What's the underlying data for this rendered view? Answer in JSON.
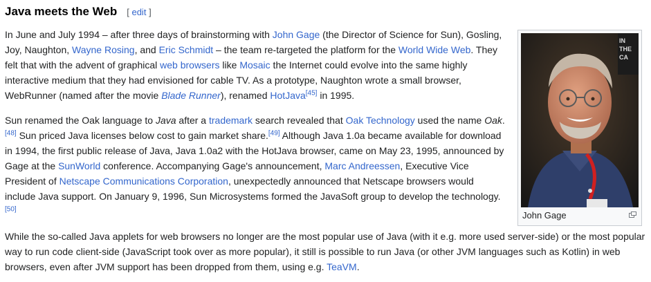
{
  "section": {
    "title": "Java meets the Web",
    "edit_open": "[",
    "edit_label": "edit",
    "edit_close": "]"
  },
  "paragraph1": {
    "t1": "In June and July 1994 – after three days of brainstorming with ",
    "link_john_gage": "John Gage",
    "t2": " (the Director of Science for Sun), Gosling, Joy, Naughton, ",
    "link_wayne_rosing": "Wayne Rosing",
    "t3": ", and ",
    "link_eric_schmidt": "Eric Schmidt",
    "t4": " – the team re-targeted the platform for the ",
    "link_www": "World Wide Web",
    "t5": ". They felt that with the advent of graphical ",
    "link_web_browsers": "web browsers",
    "t6": " like ",
    "link_mosaic": "Mosaic",
    "t7": " the Internet could evolve into the same highly interactive medium that they had envisioned for cable TV. As a prototype, Naughton wrote a small browser, WebRunner (named after the movie ",
    "link_blade_runner": "Blade Runner",
    "t8": "), renamed ",
    "link_hotjava": "HotJava",
    "ref45": "[45]",
    "t9": " in 1995."
  },
  "paragraph2": {
    "t1": "Sun renamed the Oak language to ",
    "em_java": "Java",
    "t2": " after a ",
    "link_trademark": "trademark",
    "t3": " search revealed that ",
    "link_oak_technology": "Oak Technology",
    "t4": " used the name ",
    "em_oak": "Oak",
    "t5": ".",
    "ref48": "[48]",
    "t6": " Sun priced Java licenses below cost to gain market share.",
    "ref49": "[49]",
    "t7": " Although Java 1.0a became available for download in 1994, the first public release of Java, Java 1.0a2 with the HotJava browser, came on May 23, 1995, announced by Gage at the ",
    "link_sunworld": "SunWorld",
    "t8": " conference. Accompanying Gage's announcement, ",
    "link_marc_andreessen": "Marc Andreessen",
    "t9": ", Executive Vice President of ",
    "link_netscape": "Netscape Communications Corporation",
    "t10": ", unexpectedly announced that Netscape browsers would include Java support. On January 9, 1996, Sun Microsystems formed the JavaSoft group to develop the technology.",
    "ref50": "[50]"
  },
  "paragraph3": {
    "t1": "While the so-called Java applets for web browsers no longer are the most popular use of Java (with it e.g. more used server-side) or the most popular way to run code client-side (JavaScript took over as more popular), it still is possible to run Java (or other JVM languages such as Kotlin) in web browsers, even after JVM support has been dropped from them, using e.g. ",
    "link_teavm": "TeaVM",
    "t2": "."
  },
  "figure": {
    "caption": "John Gage",
    "photo_sign_text": "IN THE CA",
    "icon": "magnify-clip-icon"
  },
  "colors": {
    "link": "#3366cc",
    "text": "#202122",
    "thumb_border": "#c8ccd1"
  }
}
